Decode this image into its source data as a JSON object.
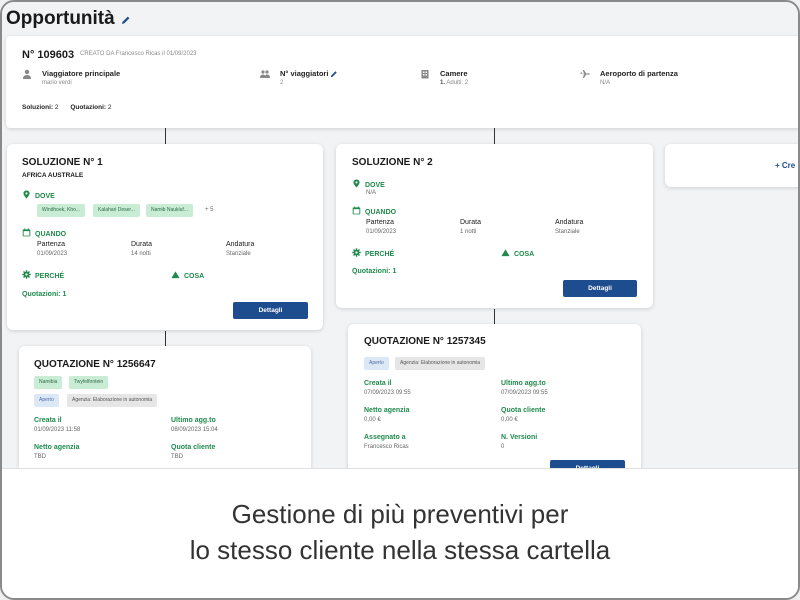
{
  "page": {
    "title": "Opportunità"
  },
  "header": {
    "number": "N° 109603",
    "created": "CREATO DA Francesco Ricas il 01/09/2023",
    "fields": [
      {
        "icon": "person-icon",
        "label": "Viaggiatore principale",
        "value": "mario verdi"
      },
      {
        "icon": "group-icon",
        "label": "N° viaggiatori",
        "value": "2"
      },
      {
        "icon": "building-icon",
        "label": "Camere",
        "value_prefix": "1.",
        "value": "Adulti: 2"
      },
      {
        "icon": "airplane-icon",
        "label": "Aeroporto di partenza",
        "value": "N/A"
      }
    ],
    "solutions_label": "Soluzioni:",
    "solutions_count": "2",
    "quotes_label": "Quotazioni:",
    "quotes_count": "2"
  },
  "solution1": {
    "title": "SOLUZIONE N° 1",
    "subtitle": "AFRICA AUSTRALE",
    "where_label": "DOVE",
    "where_chips": [
      "Windhoek, Kho...",
      "Kalahari Deser...",
      "Namib Naukluf..."
    ],
    "where_more": "+ 5",
    "when_label": "QUANDO",
    "departure_label": "Partenza",
    "departure_value": "01/09/2023",
    "duration_label": "Durata",
    "duration_value": "14 notti",
    "direction_label": "Andatura",
    "direction_value": "Stanziale",
    "why_label": "PERCHÉ",
    "what_label": "COSA",
    "quotes": "Quotazioni: 1",
    "details_button": "Dettagli"
  },
  "solution2": {
    "title": "SOLUZIONE N° 2",
    "where_label": "DOVE",
    "where_value": "N/A",
    "when_label": "QUANDO",
    "departure_label": "Partenza",
    "departure_value": "01/09/2023",
    "duration_label": "Durata",
    "duration_value": "1 notti",
    "direction_label": "Andatura",
    "direction_value": "Stanziale",
    "why_label": "PERCHÉ",
    "what_label": "COSA",
    "quotes": "Quotazioni: 1",
    "details_button": "Dettagli"
  },
  "create_card": {
    "label": "+ Cre"
  },
  "quote1": {
    "title": "QUOTAZIONE N° 1256647",
    "chips": [
      "Namibia",
      "Twyfelfontein"
    ],
    "status": "Aperto",
    "agency": "Agenzia: Elaborazione in autonomia",
    "created_label": "Creata il",
    "created_value": "01/09/2023 11:58",
    "updated_label": "Ultimo agg.to",
    "updated_value": "08/09/2023 15:04",
    "net_label": "Netto agenzia",
    "net_value": "TBD",
    "client_label": "Quota cliente",
    "client_value": "TBD"
  },
  "quote2": {
    "title": "QUOTAZIONE N° 1257345",
    "status": "Aperto",
    "agency": "Agenzia: Elaborazione in autonomia",
    "created_label": "Creata il",
    "created_value": "07/09/2023 09:55",
    "updated_label": "Ultimo agg.to",
    "updated_value": "07/09/2023 09:55",
    "net_label": "Netto agenzia",
    "net_value": "0,00 €",
    "client_label": "Quota cliente",
    "client_value": "0,00 €",
    "assigned_label": "Assegnato a",
    "assigned_value": "Francesco Ricas",
    "versions_label": "N. Versioni",
    "versions_value": "0",
    "details_button": "Dettagli"
  },
  "caption": {
    "line1": "Gestione di più preventivi per",
    "line2": "lo stesso cliente nella stessa cartella"
  },
  "colors": {
    "accent_green": "#1f8a4c",
    "button_blue": "#1e4d8f",
    "chip_green": "#c9ecd5"
  }
}
